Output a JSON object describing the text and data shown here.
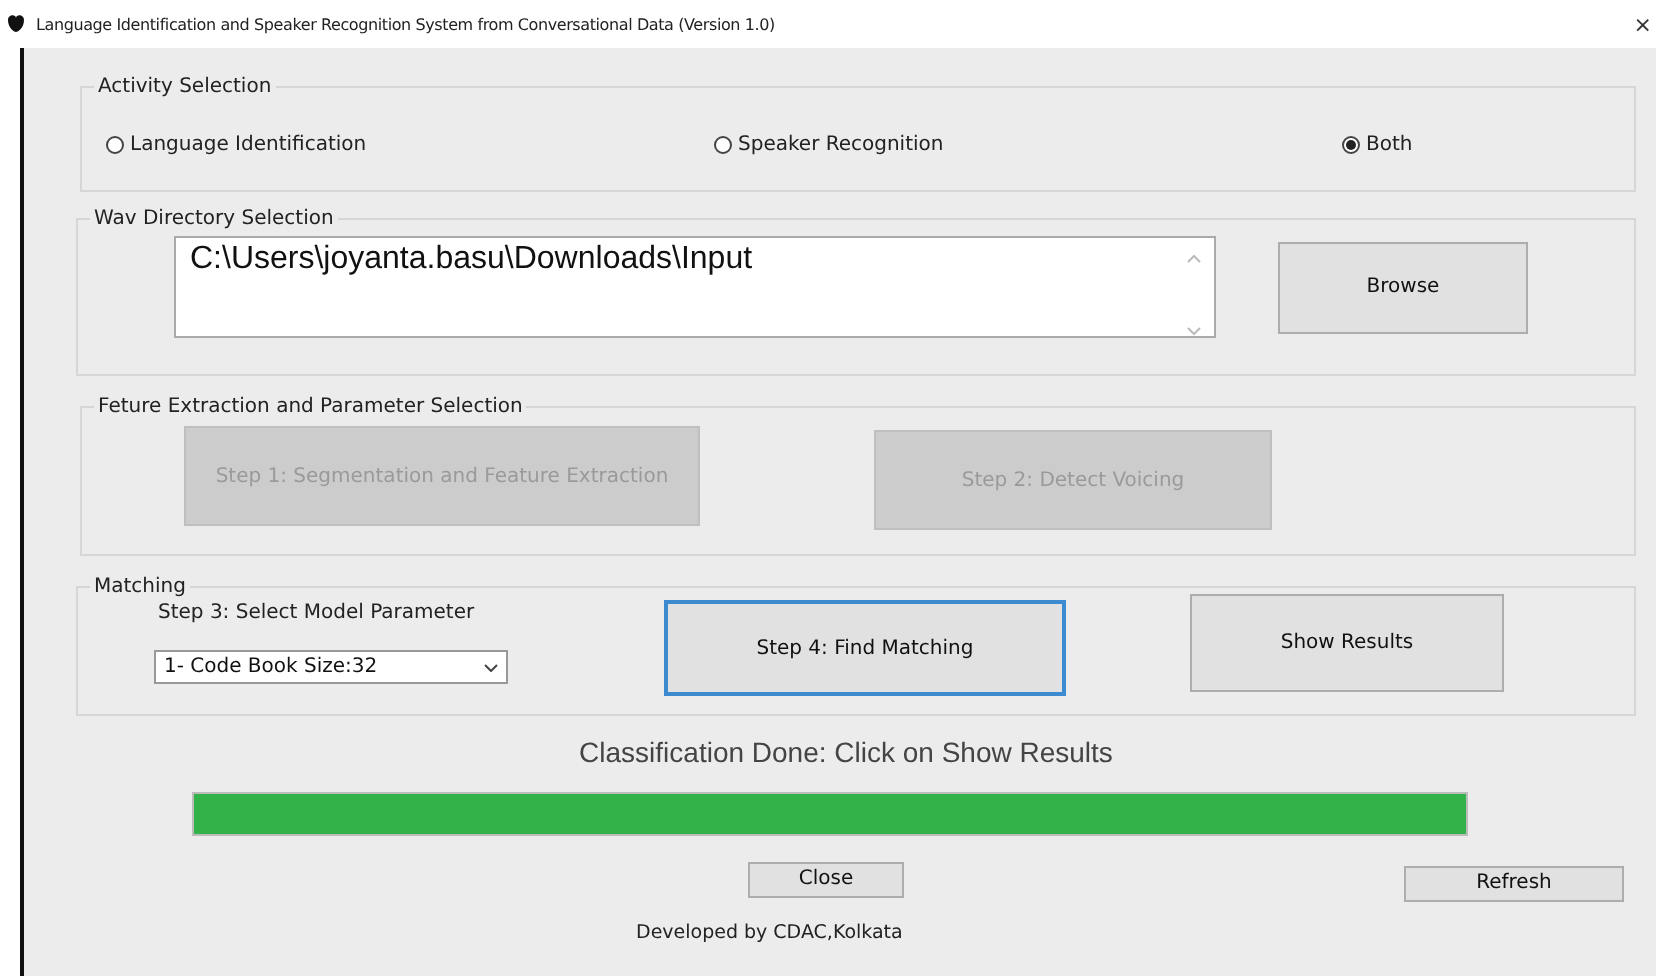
{
  "window": {
    "title": "Language Identification and Speaker Recognition System from Conversational Data (Version 1.0)",
    "close": "×"
  },
  "activity_selection": {
    "title": "Activity Selection",
    "options": [
      {
        "label": "Language Identification",
        "selected": false
      },
      {
        "label": "Speaker Recognition",
        "selected": false
      },
      {
        "label": "Both",
        "selected": true
      }
    ]
  },
  "wav_directory": {
    "title": "Wav Directory Selection",
    "path": "C:\\Users\\joyanta.basu\\Downloads\\Input",
    "browse": "Browse"
  },
  "feature_extraction": {
    "title": "Feture Extraction and Parameter Selection",
    "buttons": [
      {
        "label": "Step 1: Segmentation and Feature Extraction",
        "disabled": true
      },
      {
        "label": "Step 2: Detect Voicing",
        "disabled": true
      }
    ]
  },
  "matching": {
    "title": "Matching",
    "parameter_label": "Step 3: Select Model Parameter",
    "parameter_value": "1- Code Book Size:32",
    "buttons": [
      {
        "label": "Step 4: Find Matching",
        "focused": true
      },
      {
        "label": "Show Results",
        "focused": false
      }
    ]
  },
  "status": "Classification Done: Click on Show Results",
  "progress": {
    "level": 1
  },
  "buttons": [
    {
      "label": "Close"
    },
    {
      "label": "Refresh"
    }
  ],
  "footer": "Developed by CDAC,Kolkata"
}
